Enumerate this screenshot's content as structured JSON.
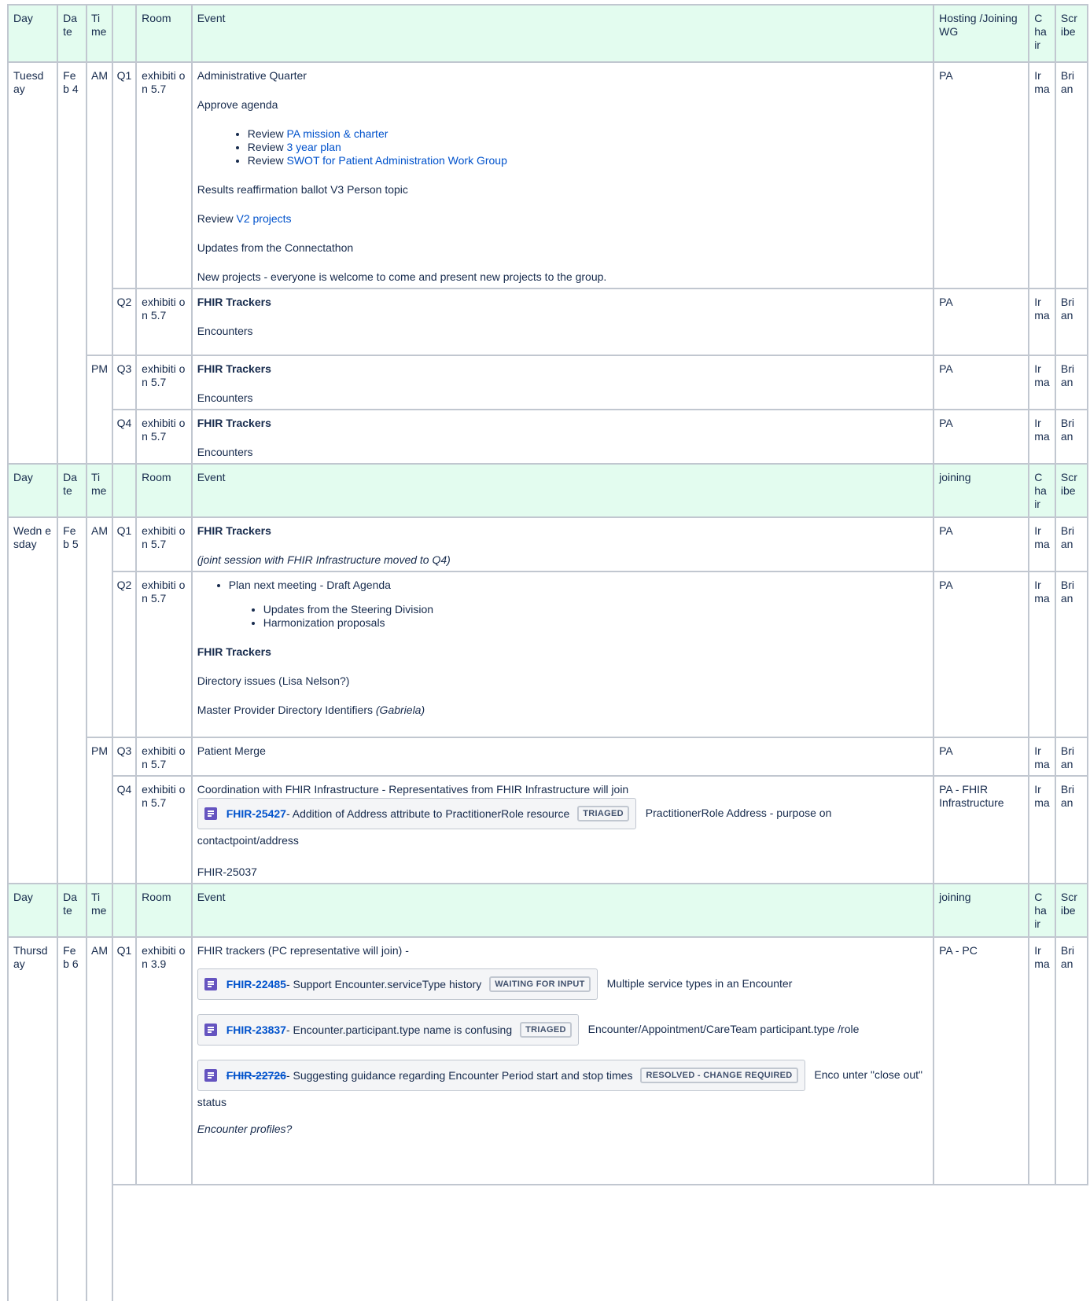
{
  "header": {
    "day": "Day",
    "date": "Da te",
    "time": "Ti me",
    "q": "",
    "room": "Room",
    "event": "Event",
    "hosting_first": "Hosting /Joining WG",
    "hosting_other": "joining",
    "chair": "C ha ir",
    "scribe": "Scr ibe"
  },
  "tuesday": {
    "day": "Tuesd ay",
    "date": "Fe b 4",
    "am": "AM",
    "pm": "PM",
    "q1": {
      "q": "Q1",
      "room": "exhibiti on 5.7",
      "title": "Administrative Quarter",
      "approve": "Approve agenda",
      "review_word": "Review",
      "links": [
        "PA mission & charter",
        "3 year plan",
        "SWOT for Patient Administration Work Group"
      ],
      "results": "Results reaffirmation ballot V3 Person topic",
      "review_v2_prefix": "Review",
      "review_v2_link": "V2 projects",
      "connectathon": "Updates from the Connectathon",
      "new_projects": "New projects - everyone is welcome to come and present new projects to the group.",
      "host": "PA",
      "chair": "Ir ma",
      "scribe": "Bri an"
    },
    "q2": {
      "q": "Q2",
      "room": "exhibiti on 5.7",
      "title": "FHIR Trackers",
      "sub": "Encounters",
      "host": "PA",
      "chair": "Ir ma",
      "scribe": "Bri an"
    },
    "q3": {
      "q": "Q3",
      "room": "exhibiti on 5.7",
      "title": "FHIR Trackers",
      "sub": "Encounters",
      "host": "PA",
      "chair": "Ir ma",
      "scribe": "Bri an"
    },
    "q4": {
      "q": "Q4",
      "room": "exhibiti on 5.7",
      "title": "FHIR Trackers",
      "sub": "Encounters",
      "host": "PA",
      "chair": "Ir ma",
      "scribe": "Bri an"
    }
  },
  "wednesday": {
    "day": "Wedn esday",
    "date": "Fe b 5",
    "am": "AM",
    "pm": "PM",
    "q1": {
      "q": "Q1",
      "room": "exhibiti on 5.7",
      "title": "FHIR Trackers",
      "note": "(joint session with FHIR Infrastructure moved to Q4)",
      "host": "PA",
      "chair": "Ir ma",
      "scribe": "Bri an"
    },
    "q2": {
      "q": "Q2",
      "room": "exhibiti on 5.7",
      "plan": "Plan next meeting - Draft Agenda",
      "sub_items": [
        "Updates from the Steering Division",
        "Harmonization proposals"
      ],
      "title": "FHIR Trackers",
      "directory": "Directory issues (Lisa Nelson?)",
      "mpd": "Master Provider Directory Identifiers",
      "mpd_who": "(Gabriela)",
      "host": "PA",
      "chair": "Ir ma",
      "scribe": "Bri an"
    },
    "q3": {
      "q": "Q3",
      "room": "exhibiti on 5.7",
      "title": "Patient Merge",
      "host": "PA",
      "chair": "Ir ma",
      "scribe": "Bri an"
    },
    "q4": {
      "q": "Q4",
      "room": "exhibiti on 5.7",
      "intro": "Coordination with FHIR Infrastructure - Representatives from FHIR Infrastructure will join",
      "issue_key": "FHIR-25427",
      "issue_summary": " - Addition of Address attribute to PractitionerRole resource",
      "issue_status": "TRIAGED",
      "issue_after": "PractitionerRole Address - purpose on contactpoint/address",
      "other": "FHIR-25037",
      "host": "PA - FHIR Infrastructure",
      "chair": "Ir ma",
      "scribe": "Bri an"
    }
  },
  "thursday": {
    "day": "Thursd ay",
    "date": "Fe b 6",
    "am": "AM",
    "q1": {
      "q": "Q1",
      "room": "exhibiti on 3.9",
      "intro": "FHIR trackers (PC representative will join) -",
      "issues": [
        {
          "key": "FHIR-22485",
          "summary": " - Support Encounter.serviceType history",
          "status": "WAITING FOR INPUT",
          "after": "Multiple service types in an Encounter"
        },
        {
          "key": "FHIR-23837",
          "summary": " - Encounter.participant.type name is confusing",
          "status": "TRIAGED",
          "after": "Encounter/Appointment/CareTeam participant.type /role"
        },
        {
          "key": "FHIR-22726",
          "summary": " - Suggesting guidance regarding Encounter Period start and stop times",
          "status": "RESOLVED - CHANGE REQUIRED",
          "after": "Enco unter \"close out\" status"
        }
      ],
      "profiles": "Encounter profiles?",
      "host": "PA - PC",
      "chair": "Ir ma",
      "scribe": "Bri an"
    }
  },
  "colors": {
    "header_bg": "#e3fcef",
    "border": "#c1c7d0",
    "link": "#0052cc",
    "jira_icon": "#6554c0"
  }
}
